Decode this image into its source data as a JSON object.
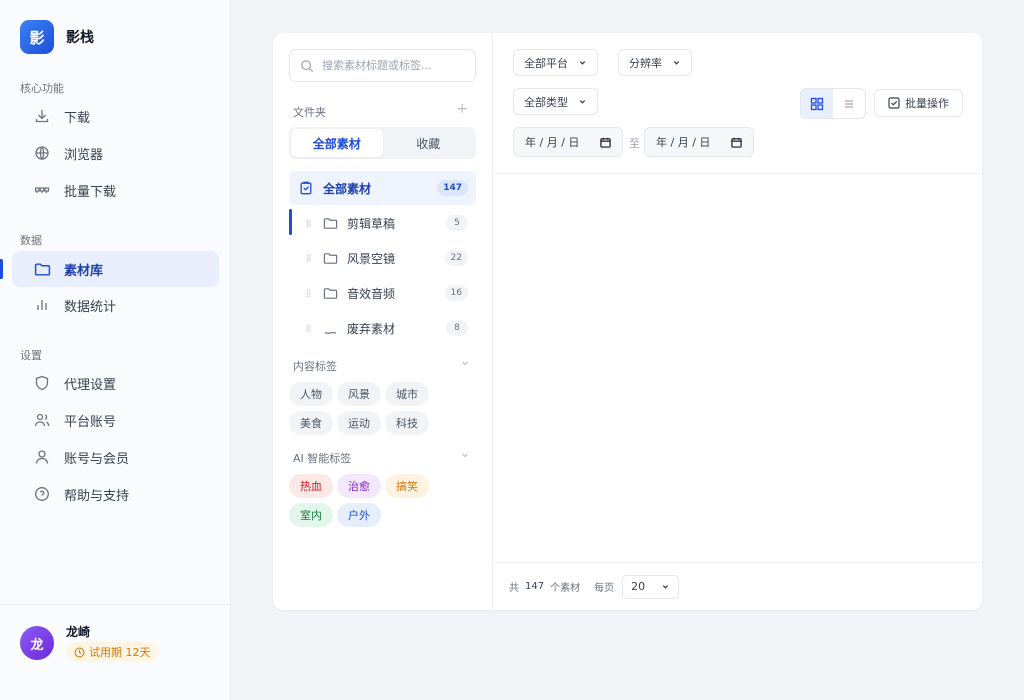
{
  "brand": {
    "logo_char": "影",
    "name": "影栈"
  },
  "nav": {
    "sections": [
      {
        "title": "核心功能",
        "items": [
          {
            "label": "下载",
            "icon": "download-icon"
          },
          {
            "label": "浏览器",
            "icon": "globe-icon"
          },
          {
            "label": "批量下载",
            "icon": "batch-download-icon"
          }
        ]
      },
      {
        "title": "数据",
        "items": [
          {
            "label": "素材库",
            "icon": "folder-icon",
            "active": true
          },
          {
            "label": "数据统计",
            "icon": "bar-chart-icon"
          }
        ]
      },
      {
        "title": "设置",
        "items": [
          {
            "label": "代理设置",
            "icon": "shield-icon"
          },
          {
            "label": "平台账号",
            "icon": "users-icon"
          },
          {
            "label": "账号与会员",
            "icon": "user-icon"
          },
          {
            "label": "帮助与支持",
            "icon": "help-circle-icon"
          }
        ]
      }
    ]
  },
  "user": {
    "avatar_char": "龙",
    "name": "龙崎",
    "badge": "试用期 12天"
  },
  "panel": {
    "search_placeholder": "搜索素材标题或标签...",
    "folder_header": "文件夹",
    "tabs": [
      "全部素材",
      "收藏"
    ],
    "folders": [
      {
        "label": "全部素材",
        "count": "147",
        "active": true
      },
      {
        "label": "剪辑草稿",
        "count": "5"
      },
      {
        "label": "风景空镜",
        "count": "22"
      },
      {
        "label": "音效音频",
        "count": "16"
      },
      {
        "label": "废弃素材",
        "count": "8"
      }
    ],
    "content_tags_title": "内容标签",
    "content_tags": [
      "人物",
      "风景",
      "城市",
      "美食",
      "运动",
      "科技"
    ],
    "ai_tags_title": "AI 智能标签",
    "ai_tags": [
      {
        "label": "热血",
        "bg": "#fde8e8",
        "color": "#c81e1e"
      },
      {
        "label": "治愈",
        "bg": "#f3e8fd",
        "color": "#7e22ce"
      },
      {
        "label": "搞笑",
        "bg": "#fef3e2",
        "color": "#d97706"
      },
      {
        "label": "室内",
        "bg": "#e3f6ea",
        "color": "#15803d"
      },
      {
        "label": "户外",
        "bg": "#e6eefc",
        "color": "#1d4ed8"
      }
    ]
  },
  "filters": {
    "platform": "全部平台",
    "resolution": "分辨率",
    "type": "全部类型",
    "date_placeholder": "年 / 月 / 日",
    "date_sep": "至",
    "batch_label": "批量操作"
  },
  "footer": {
    "total_prefix": "共",
    "total": "147",
    "total_suffix": "个素材",
    "per_page_label": "每页",
    "per_page": "20"
  }
}
